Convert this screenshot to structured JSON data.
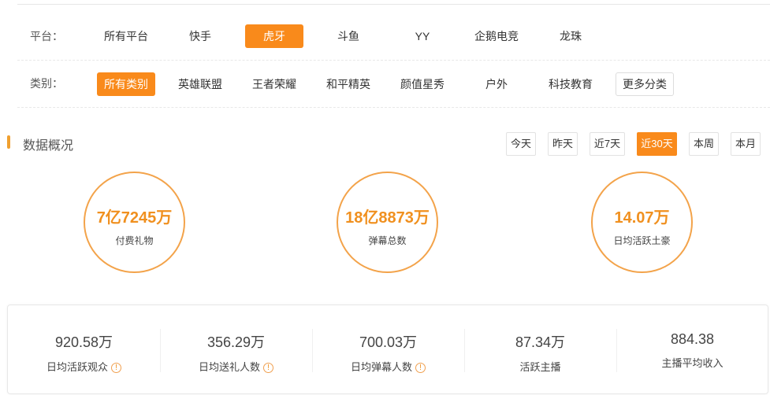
{
  "platform": {
    "label": "平台：",
    "items": [
      "所有平台",
      "快手",
      "虎牙",
      "斗鱼",
      "YY",
      "企鹅电竞",
      "龙珠"
    ],
    "active": 2
  },
  "category": {
    "label": "类别：",
    "items": [
      "所有类别",
      "英雄联盟",
      "王者荣耀",
      "和平精英",
      "颜值星秀",
      "户外",
      "科技教育"
    ],
    "more": "更多分类",
    "active": 0
  },
  "overview": {
    "title": "数据概况",
    "ranges": [
      "今天",
      "昨天",
      "近7天",
      "近30天",
      "本周",
      "本月"
    ],
    "active_range": 3
  },
  "circles": [
    {
      "value": "7亿7245万",
      "label": "付费礼物"
    },
    {
      "value": "18亿8873万",
      "label": "弹幕总数"
    },
    {
      "value": "14.07万",
      "label": "日均活跃土豪"
    }
  ],
  "stats": [
    {
      "value": "920.58万",
      "label": "日均活跃观众",
      "info": true
    },
    {
      "value": "356.29万",
      "label": "日均送礼人数",
      "info": true
    },
    {
      "value": "700.03万",
      "label": "日均弹幕人数",
      "info": true
    },
    {
      "value": "87.34万",
      "label": "活跃主播",
      "info": false
    },
    {
      "value": "884.38",
      "label": "主播平均收入",
      "info": false
    }
  ],
  "colors": {
    "accent": "#f98a1b"
  }
}
